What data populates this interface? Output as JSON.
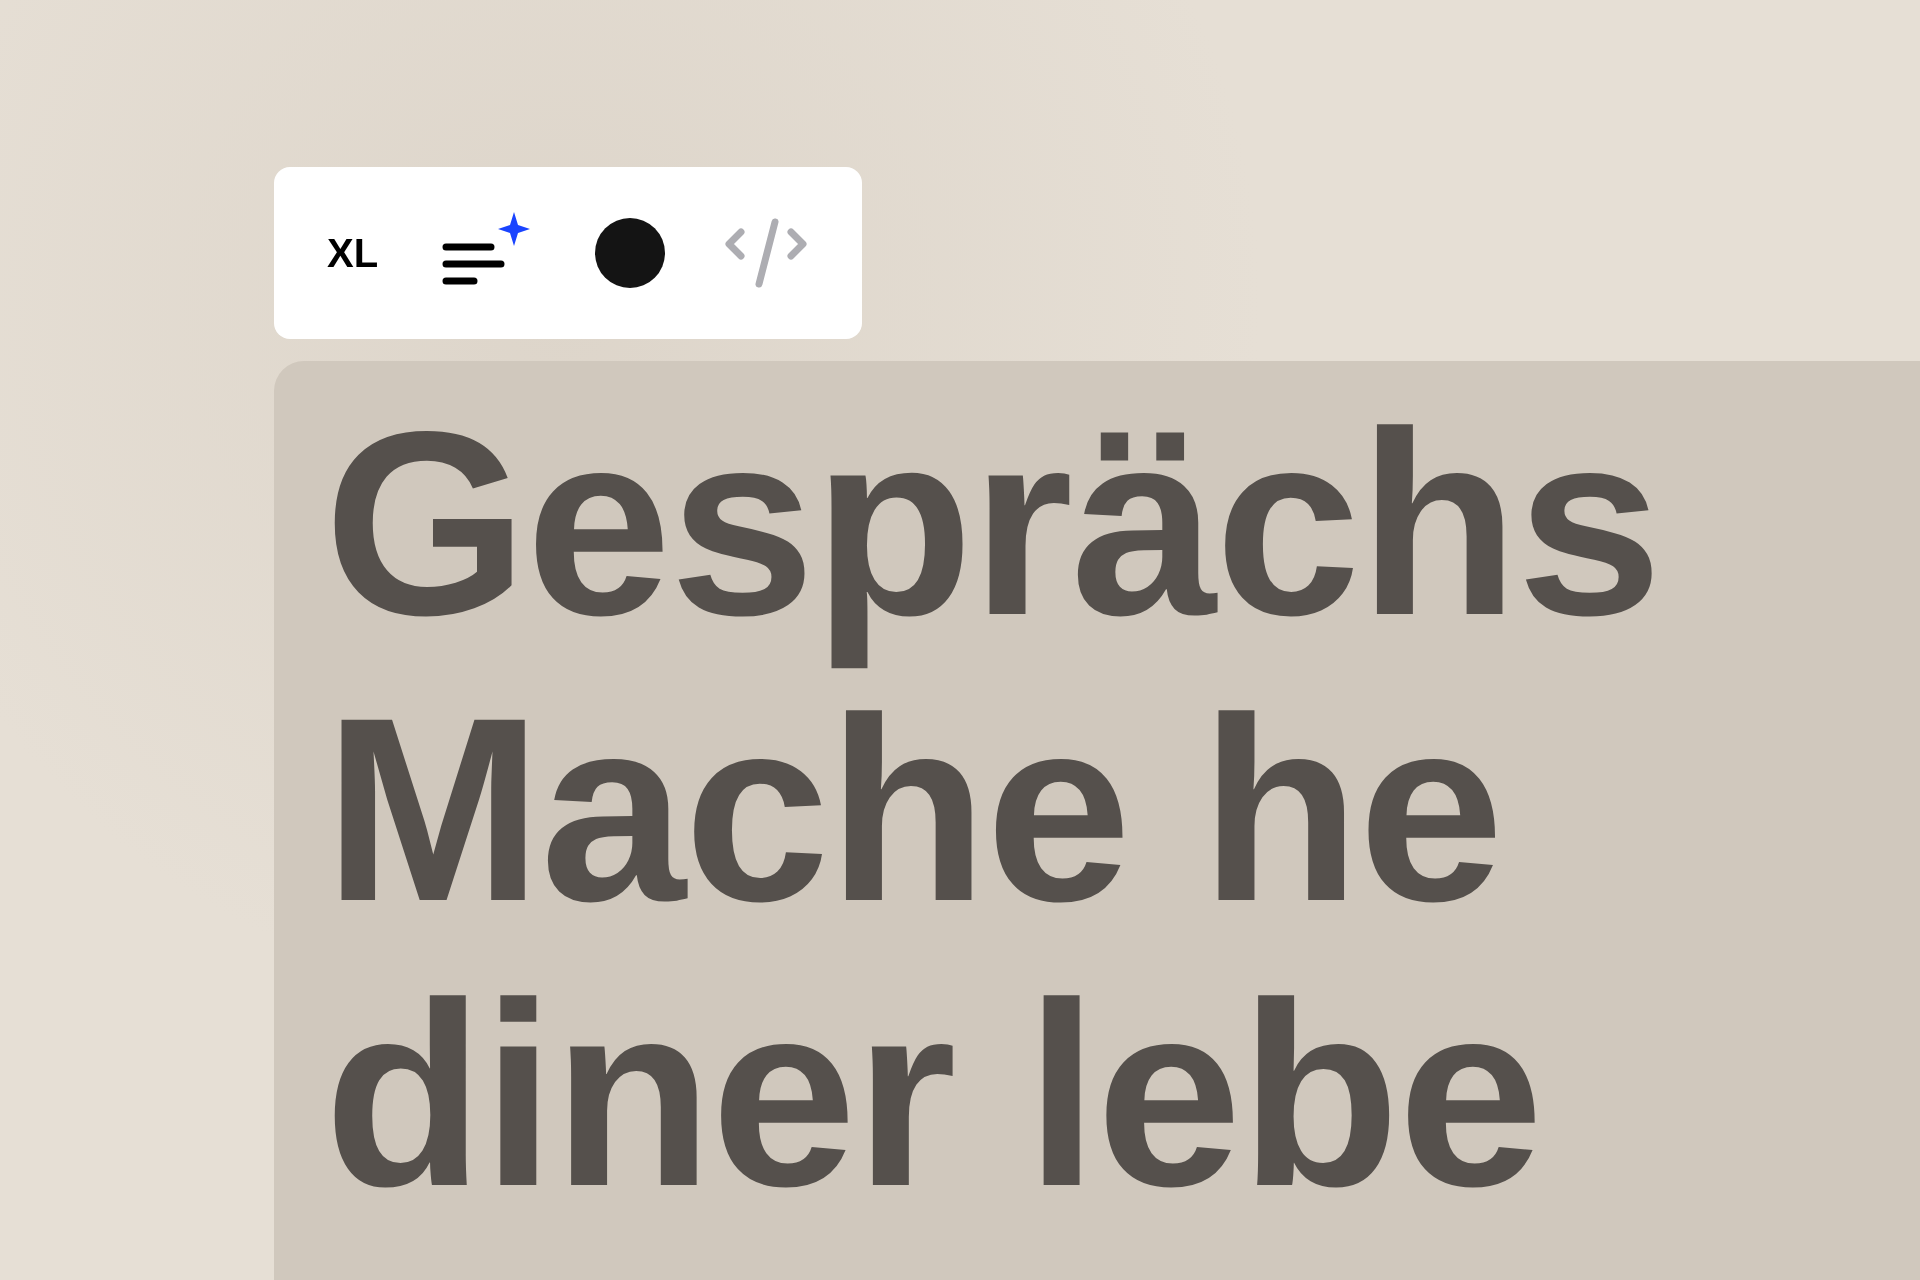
{
  "toolbar": {
    "items": [
      {
        "kind": "size",
        "label": "XL"
      },
      {
        "kind": "ai-format"
      },
      {
        "kind": "color",
        "color": "#141414"
      },
      {
        "kind": "code",
        "disabled": true
      }
    ]
  },
  "headline": {
    "lines": [
      "Gesprächs",
      "Mache he",
      "diner lebe"
    ]
  }
}
